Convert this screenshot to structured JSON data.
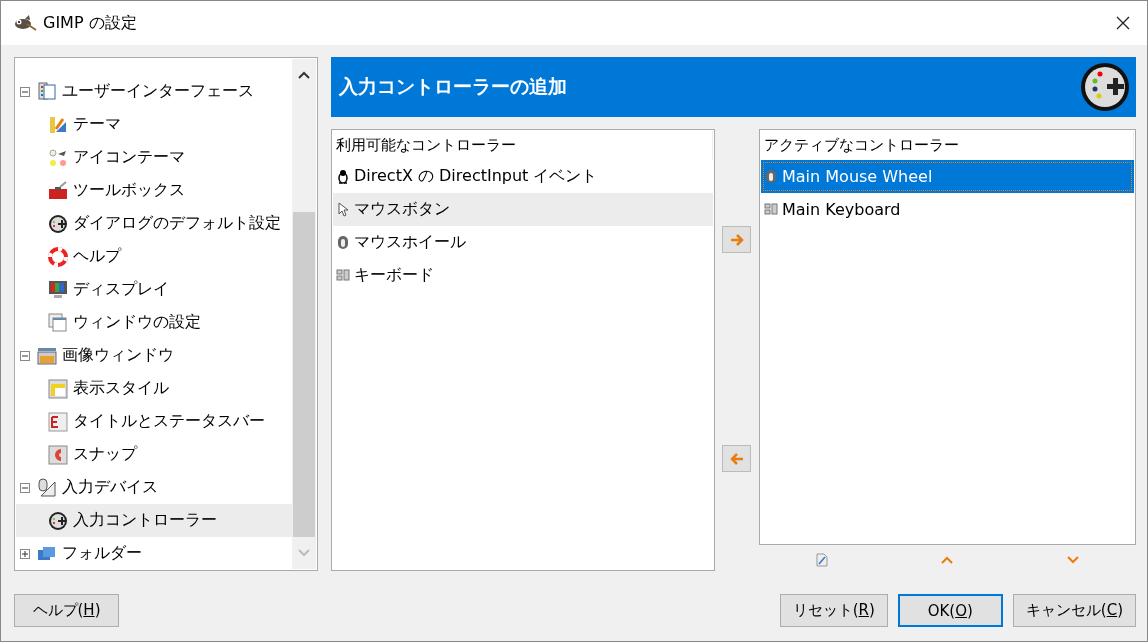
{
  "window": {
    "title": "GIMP の設定"
  },
  "tree": [
    {
      "label": "ユーザーインターフェース",
      "expanded": true,
      "selected": false,
      "children": [
        {
          "label": "テーマ",
          "selected": false
        },
        {
          "label": "アイコンテーマ",
          "selected": false
        },
        {
          "label": "ツールボックス",
          "selected": false
        },
        {
          "label": "ダイアログのデフォルト設定",
          "selected": false
        },
        {
          "label": "ヘルプ",
          "selected": false
        },
        {
          "label": "ディスプレイ",
          "selected": false
        },
        {
          "label": "ウィンドウの設定",
          "selected": false
        }
      ]
    },
    {
      "label": "画像ウィンドウ",
      "expanded": true,
      "selected": false,
      "children": [
        {
          "label": "表示スタイル",
          "selected": false
        },
        {
          "label": "タイトルとステータスバー",
          "selected": false
        },
        {
          "label": "スナップ",
          "selected": false
        }
      ]
    },
    {
      "label": "入力デバイス",
      "expanded": true,
      "selected": false,
      "children": [
        {
          "label": "入力コントローラー",
          "selected": true
        }
      ]
    },
    {
      "label": "フォルダー",
      "expanded": false,
      "selected": false
    }
  ],
  "header": {
    "title": "入力コントローラーの追加"
  },
  "available": {
    "heading": "利用可能なコントローラー",
    "items": [
      {
        "label": "DirectX の DirectInput イベント",
        "selected": false
      },
      {
        "label": "マウスボタン",
        "selected": true
      },
      {
        "label": "マウスホイール",
        "selected": false
      },
      {
        "label": "キーボード",
        "selected": false
      }
    ]
  },
  "active": {
    "heading": "アクティブなコントローラー",
    "items": [
      {
        "label": "Main Mouse Wheel",
        "selected": true
      },
      {
        "label": "Main Keyboard",
        "selected": false
      }
    ]
  },
  "buttons": [
    {
      "before": "ヘルプ(",
      "mnemonic": "H",
      "after": ")",
      "default": false
    },
    {
      "before": "リセット(",
      "mnemonic": "R",
      "after": ")",
      "default": false
    },
    {
      "before": "OK(",
      "mnemonic": "O",
      "after": ")",
      "default": true
    },
    {
      "before": "キャンセル(",
      "mnemonic": "C",
      "after": ")",
      "default": false
    }
  ]
}
